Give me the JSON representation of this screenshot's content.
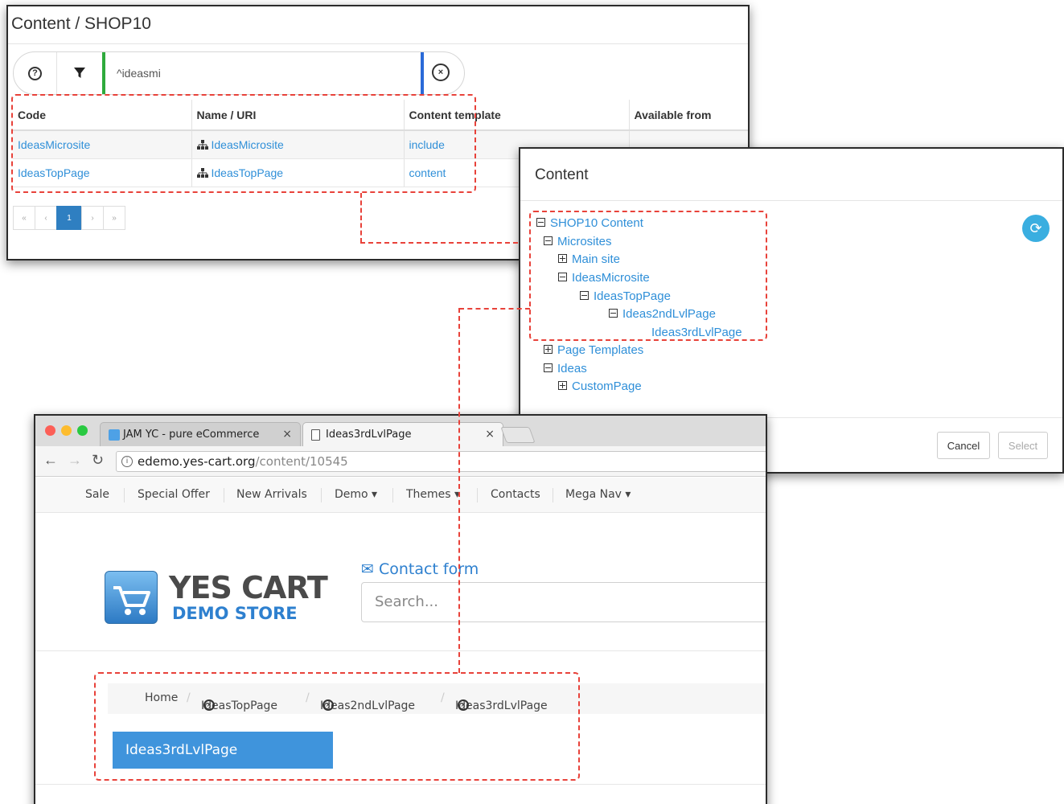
{
  "admin": {
    "title": "Content / SHOP10",
    "filter_value": "^ideasmi",
    "columns": [
      "Code",
      "Name / URI",
      "Content template",
      "Available from"
    ],
    "rows": [
      {
        "code": "IdeasMicrosite",
        "name": "IdeasMicrosite",
        "template": "include",
        "available": ""
      },
      {
        "code": "IdeasTopPage",
        "name": "IdeasTopPage",
        "template": "content",
        "available": ""
      }
    ],
    "pager": [
      "«",
      "‹",
      "1",
      "›",
      "»"
    ]
  },
  "dialog": {
    "title": "Content",
    "tree": [
      {
        "label": "SHOP10 Content",
        "state": "minus"
      },
      {
        "label": "Microsites",
        "state": "minus"
      },
      {
        "label": "Main site",
        "state": "plus"
      },
      {
        "label": "IdeasMicrosite",
        "state": "minus"
      },
      {
        "label": "IdeasTopPage",
        "state": "minus"
      },
      {
        "label": "Ideas2ndLvlPage",
        "state": "minus"
      },
      {
        "label": "Ideas3rdLvlPage",
        "state": "none"
      },
      {
        "label": "Page Templates",
        "state": "plus"
      },
      {
        "label": "Ideas",
        "state": "minus"
      },
      {
        "label": "CustomPage",
        "state": "plus"
      }
    ],
    "cancel_label": "Cancel",
    "select_label": "Select"
  },
  "browser": {
    "tabs": [
      {
        "title": "JAM YC - pure eCommerce",
        "close": "×"
      },
      {
        "title": "Ideas3rdLvlPage",
        "close": "×"
      }
    ],
    "url_host": "edemo.yes-cart.org",
    "url_path": "/content/10545",
    "nav": [
      "Sale",
      "Special Offer",
      "New Arrivals",
      "Demo ▾",
      "Themes ▾",
      "Contacts",
      "Mega Nav ▾"
    ],
    "logo_line1": "YES CART",
    "logo_line2": "DEMO STORE",
    "contact_label": "Contact form",
    "search_placeholder": "Search...",
    "breadcrumbs": [
      "Home",
      "IdeasTopPage",
      "Ideas2ndLvlPage",
      "Ideas3rdLvlPage"
    ],
    "page_button": "Ideas3rdLvlPage"
  },
  "colors": {
    "link": "#2f8fd8",
    "annotation": "#e8423a",
    "primary": "#3f94dc"
  }
}
